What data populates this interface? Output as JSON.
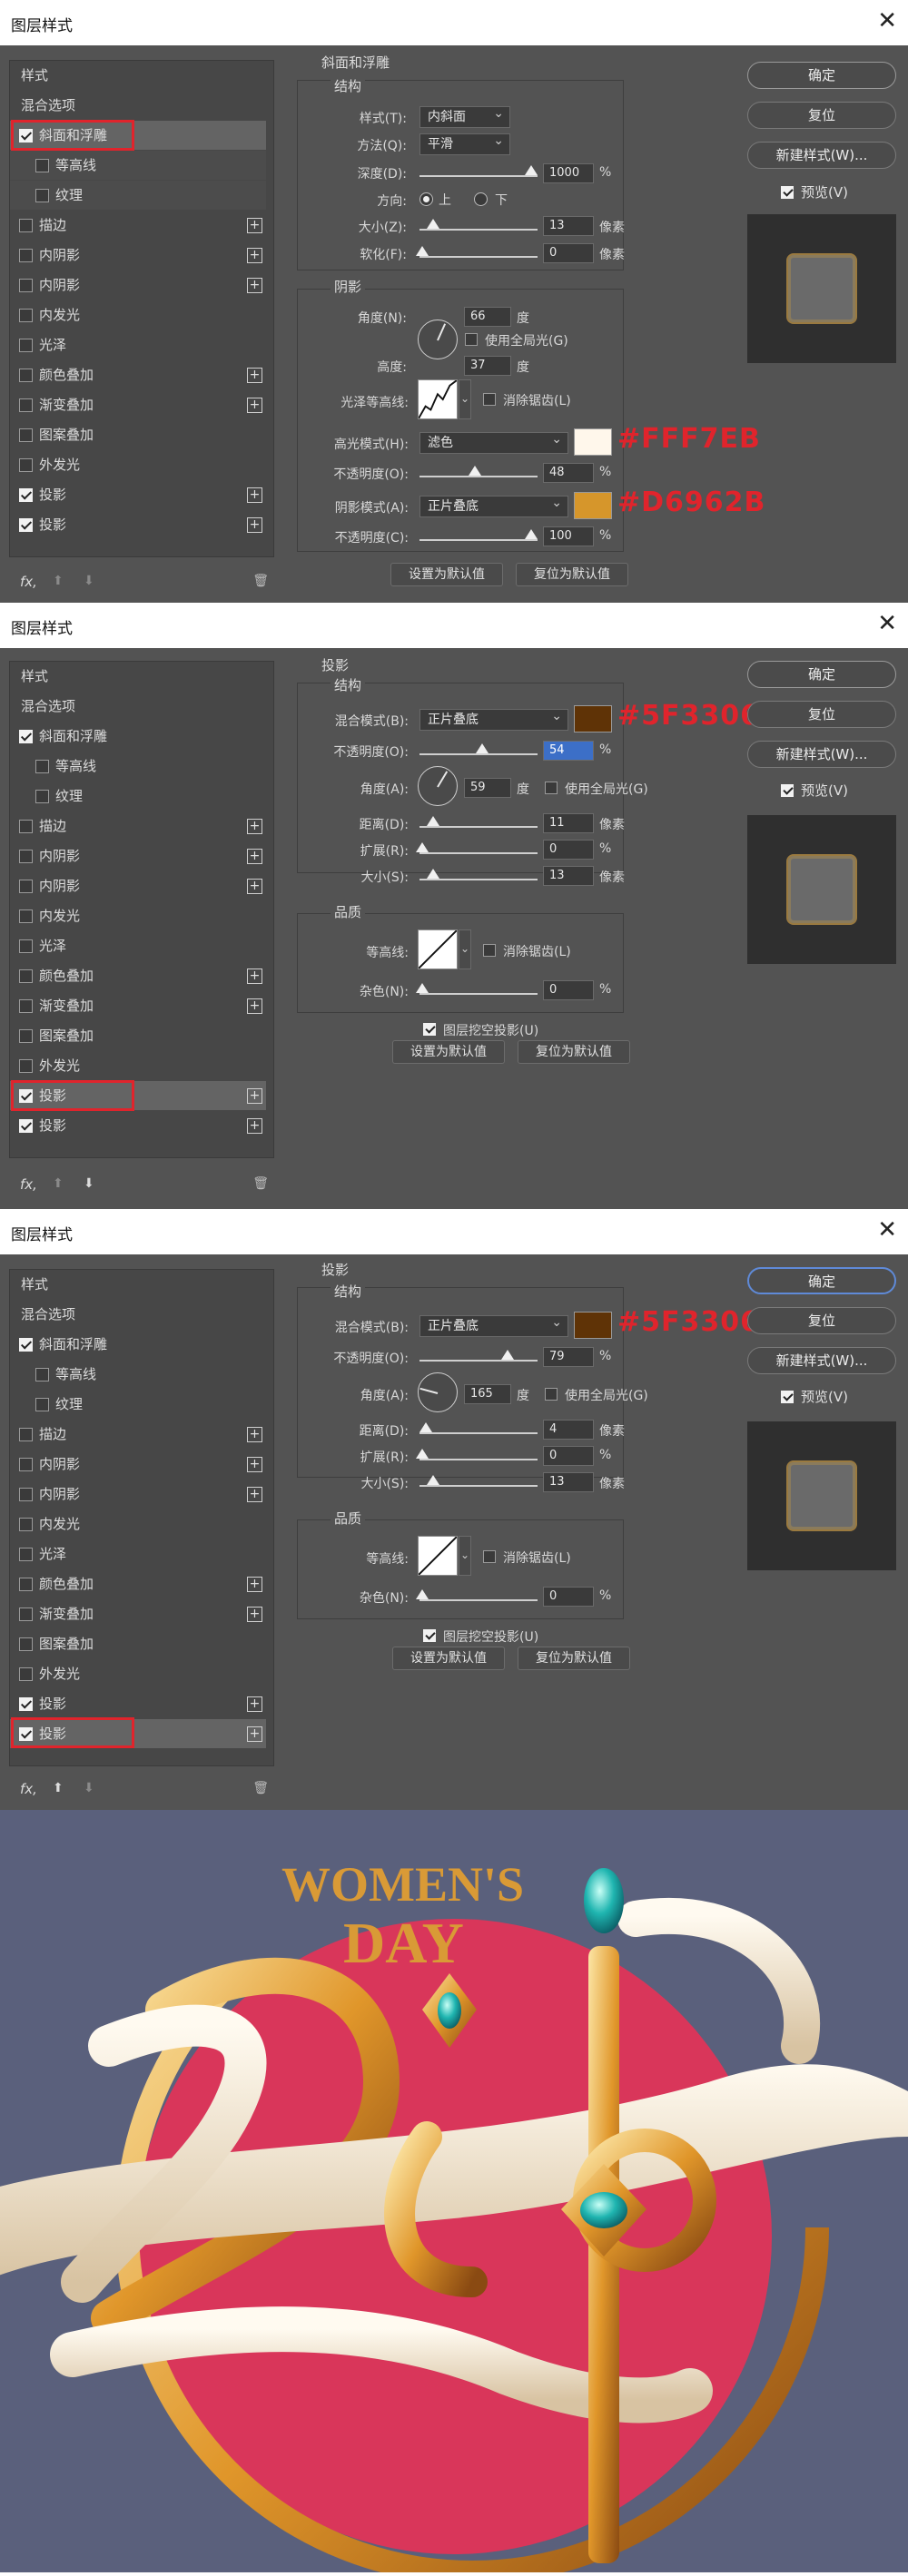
{
  "dialog_title": "图层样式",
  "style_list": [
    "样式",
    "混合选项",
    "斜面和浮雕",
    "等高线",
    "纹理",
    "描边",
    "内阴影",
    "内阴影",
    "内发光",
    "光泽",
    "颜色叠加",
    "渐变叠加",
    "图案叠加",
    "外发光",
    "投影",
    "投影"
  ],
  "buttons": {
    "ok": "确定",
    "reset": "复位",
    "new_style": "新建样式(W)...",
    "preview": "预览(V)",
    "set_default": "设置为默认值",
    "reset_default": "复位为默认值"
  },
  "colors": {
    "accent_red": "#e0242c",
    "panel_bg": "#535353",
    "highlight_hex": "#FFF7EB",
    "shadow_hex": "#D6962B",
    "drop_shadow_hex": "#5F3306"
  },
  "bevel": {
    "section": "斜面和浮雕",
    "structure": "结构",
    "style_label": "样式(T):",
    "style_value": "内斜面",
    "method_label": "方法(Q):",
    "method_value": "平滑",
    "depth_label": "深度(D):",
    "depth_value": "1000",
    "depth_unit": "%",
    "direction_label": "方向:",
    "dir_up": "上",
    "dir_down": "下",
    "size_label": "大小(Z):",
    "size_value": "13",
    "size_unit": "像素",
    "soften_label": "软化(F):",
    "soften_value": "0",
    "soften_unit": "像素",
    "shading": "阴影",
    "angle_label": "角度(N):",
    "angle_value": "66",
    "angle_unit": "度",
    "global_light": "使用全局光(G)",
    "altitude_label": "高度:",
    "altitude_value": "37",
    "altitude_unit": "度",
    "gloss_label": "光泽等高线:",
    "antialias": "消除锯齿(L)",
    "hl_mode_label": "高光模式(H):",
    "hl_mode_value": "滤色",
    "hl_opacity_label": "不透明度(O):",
    "hl_opacity_value": "48",
    "hl_opacity_unit": "%",
    "sh_mode_label": "阴影模式(A):",
    "sh_mode_value": "正片叠底",
    "sh_opacity_label": "不透明度(C):",
    "sh_opacity_value": "100",
    "sh_opacity_unit": "%"
  },
  "drop1": {
    "section": "投影",
    "structure": "结构",
    "blend_label": "混合模式(B):",
    "blend_value": "正片叠底",
    "opacity_label": "不透明度(O):",
    "opacity_value": "54",
    "opacity_unit": "%",
    "angle_label": "角度(A):",
    "angle_value": "59",
    "angle_unit": "度",
    "global_light": "使用全局光(G)",
    "distance_label": "距离(D):",
    "distance_value": "11",
    "distance_unit": "像素",
    "spread_label": "扩展(R):",
    "spread_value": "0",
    "spread_unit": "%",
    "size_label": "大小(S):",
    "size_value": "13",
    "size_unit": "像素",
    "quality": "品质",
    "contour_label": "等高线:",
    "antialias": "消除锯齿(L)",
    "noise_label": "杂色(N):",
    "noise_value": "0",
    "noise_unit": "%",
    "knockout": "图层挖空投影(U)"
  },
  "drop2": {
    "section": "投影",
    "structure": "结构",
    "blend_label": "混合模式(B):",
    "blend_value": "正片叠底",
    "opacity_label": "不透明度(O):",
    "opacity_value": "79",
    "opacity_unit": "%",
    "angle_label": "角度(A):",
    "angle_value": "165",
    "angle_unit": "度",
    "global_light": "使用全局光(G)",
    "distance_label": "距离(D):",
    "distance_value": "4",
    "distance_unit": "像素",
    "spread_label": "扩展(R):",
    "spread_value": "0",
    "spread_unit": "%",
    "size_label": "大小(S):",
    "size_value": "13",
    "size_unit": "像素",
    "quality": "品质",
    "contour_label": "等高线:",
    "antialias": "消除锯齿(L)",
    "noise_label": "杂色(N):",
    "noise_value": "0",
    "noise_unit": "%",
    "knockout": "图层挖空投影(U)"
  },
  "artwork": {
    "title_line1": "WOMEN'S",
    "title_line2": "DAY",
    "background": "#5a607c",
    "circle": "#d9365a"
  }
}
